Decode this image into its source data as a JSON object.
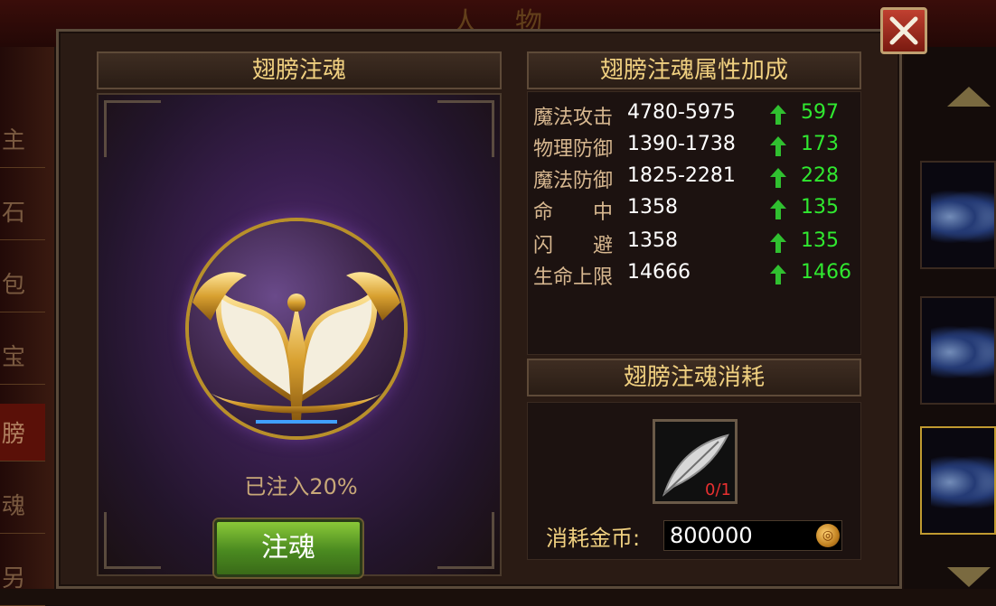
{
  "background": {
    "top_title": "人物",
    "left_tabs": [
      "主",
      "石",
      "包",
      "宝",
      "膀",
      "魂",
      "另"
    ]
  },
  "left_panel": {
    "title": "翅膀注魂",
    "progress_text": "已注入20%",
    "inject_button": "注魂"
  },
  "attributes": {
    "title": "翅膀注魂属性加成",
    "rows": [
      {
        "name": "魔法攻击",
        "value": "4780-5975",
        "bonus": "597"
      },
      {
        "name": "物理防御",
        "value": "1390-1738",
        "bonus": "173"
      },
      {
        "name": "魔法防御",
        "value": "1825-2281",
        "bonus": "228"
      },
      {
        "name": "命　　中",
        "value": "1358",
        "bonus": "135"
      },
      {
        "name": "闪　　避",
        "value": "1358",
        "bonus": "135"
      },
      {
        "name": "生命上限",
        "value": "14666",
        "bonus": "1466"
      }
    ]
  },
  "cost": {
    "title": "翅膀注魂消耗",
    "item_count": "0/1",
    "coin_label": "消耗金币:",
    "coin_value": "800000"
  },
  "colors": {
    "bonus_green": "#30e830",
    "title_gold": "#f0d080",
    "count_red": "#e83030"
  },
  "icons": [
    "close-icon",
    "up-arrow-icon",
    "feather-icon",
    "gold-coin-icon",
    "wings-emblem-icon"
  ]
}
